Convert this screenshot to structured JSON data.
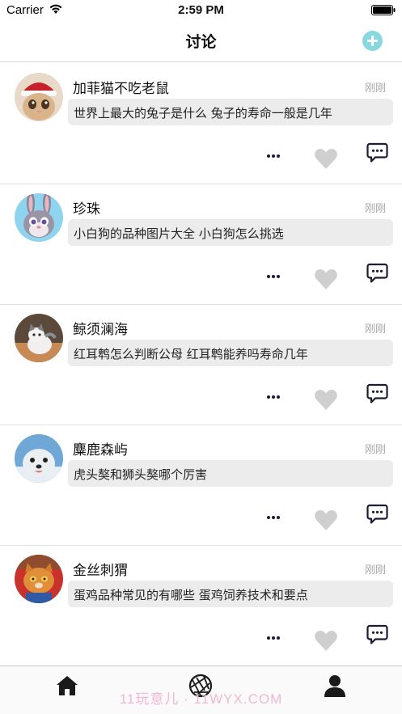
{
  "status_bar": {
    "carrier": "Carrier",
    "time": "2:59 PM"
  },
  "nav": {
    "title": "讨论"
  },
  "colors": {
    "accent": "#8ad8df",
    "bubble": "#ececec",
    "dark_icon": "#1b1b33",
    "like_gray": "#cfcfcf",
    "time_gray": "#a8a8a8"
  },
  "posts": [
    {
      "username": "加菲猫不吃老鼠",
      "time": "刚刚",
      "content": "世界上最大的兔子是什么 兔子的寿命一般是几年",
      "avatar": "kitten-santa-hat"
    },
    {
      "username": "珍珠",
      "time": "刚刚",
      "content": "小白狗的品种图片大全 小白狗怎么挑选",
      "avatar": "cartoon-bunny"
    },
    {
      "username": "鲸须澜海",
      "time": "刚刚",
      "content": "红耳鹎怎么判断公母 红耳鹎能养吗寿命几年",
      "avatar": "kitten-photo"
    },
    {
      "username": "麋鹿森屿",
      "time": "刚刚",
      "content": "虎头獒和狮头獒哪个厉害",
      "avatar": "seal-photo"
    },
    {
      "username": "金丝刺猬",
      "time": "刚刚",
      "content": "蛋鸡品种常见的有哪些 蛋鸡饲养技术和要点",
      "avatar": "orange-cat-photo"
    }
  ],
  "icons": {
    "more": "more-dots-icon",
    "like": "heart-icon",
    "comment": "comment-icon"
  },
  "tabs": [
    {
      "name": "home",
      "icon": "home-icon"
    },
    {
      "name": "discover",
      "icon": "aperture-icon"
    },
    {
      "name": "profile",
      "icon": "person-icon"
    }
  ],
  "watermark": "11玩意儿 · 11WYX.COM"
}
